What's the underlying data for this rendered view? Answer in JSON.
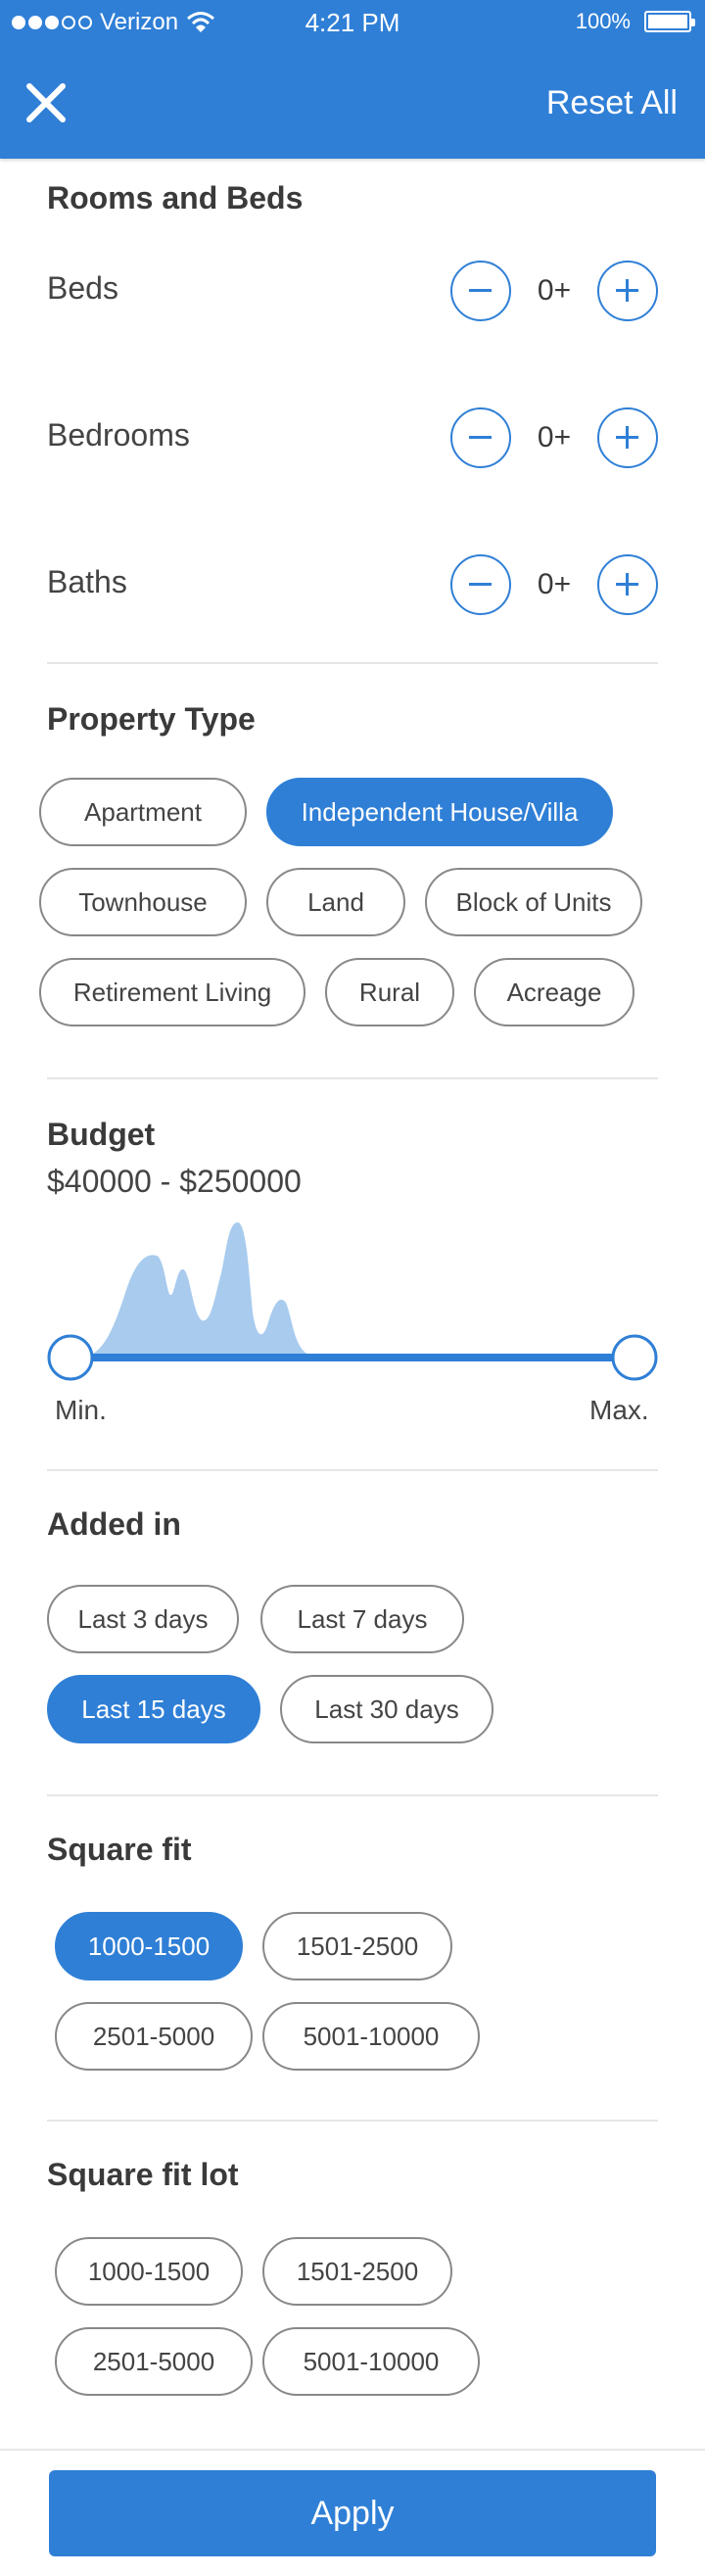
{
  "status_bar": {
    "carrier": "Verizon",
    "time": "4:21 PM",
    "battery": "100%"
  },
  "nav": {
    "reset_label": "Reset All",
    "close_icon": "close-icon"
  },
  "rooms": {
    "title": "Rooms and Beds",
    "rows": [
      {
        "label": "Beds",
        "value": "0+"
      },
      {
        "label": "Bedrooms",
        "value": "0+"
      },
      {
        "label": "Baths",
        "value": "0+"
      }
    ]
  },
  "property_type": {
    "title": "Property Type",
    "options": [
      {
        "label": "Apartment",
        "selected": false
      },
      {
        "label": "Independent House/Villa",
        "selected": true
      },
      {
        "label": "Townhouse",
        "selected": false
      },
      {
        "label": "Land",
        "selected": false
      },
      {
        "label": "Block of Units",
        "selected": false
      },
      {
        "label": "Retirement Living",
        "selected": false
      },
      {
        "label": "Rural",
        "selected": false
      },
      {
        "label": "Acreage",
        "selected": false
      }
    ]
  },
  "budget": {
    "title": "Budget",
    "range_text": "$40000 - $250000",
    "min_label": "Min.",
    "max_label": "Max."
  },
  "added_in": {
    "title": "Added in",
    "options": [
      {
        "label": "Last 3 days",
        "selected": false
      },
      {
        "label": "Last 7 days",
        "selected": false
      },
      {
        "label": "Last 15 days",
        "selected": true
      },
      {
        "label": "Last 30 days",
        "selected": false
      }
    ]
  },
  "square_fit": {
    "title": "Square fit",
    "options": [
      {
        "label": "1000-1500",
        "selected": true
      },
      {
        "label": "1501-2500",
        "selected": false
      },
      {
        "label": "2501-5000",
        "selected": false
      },
      {
        "label": "5001-10000",
        "selected": false
      }
    ]
  },
  "square_fit_lot": {
    "title": "Square fit lot",
    "options": [
      {
        "label": "1000-1500",
        "selected": false
      },
      {
        "label": "1501-2500",
        "selected": false
      },
      {
        "label": "2501-5000",
        "selected": false
      },
      {
        "label": "5001-10000",
        "selected": false
      }
    ]
  },
  "apply_label": "Apply",
  "colors": {
    "accent": "#2f7fd6",
    "histogram": "#a8cbee",
    "chip_border": "#888888"
  }
}
